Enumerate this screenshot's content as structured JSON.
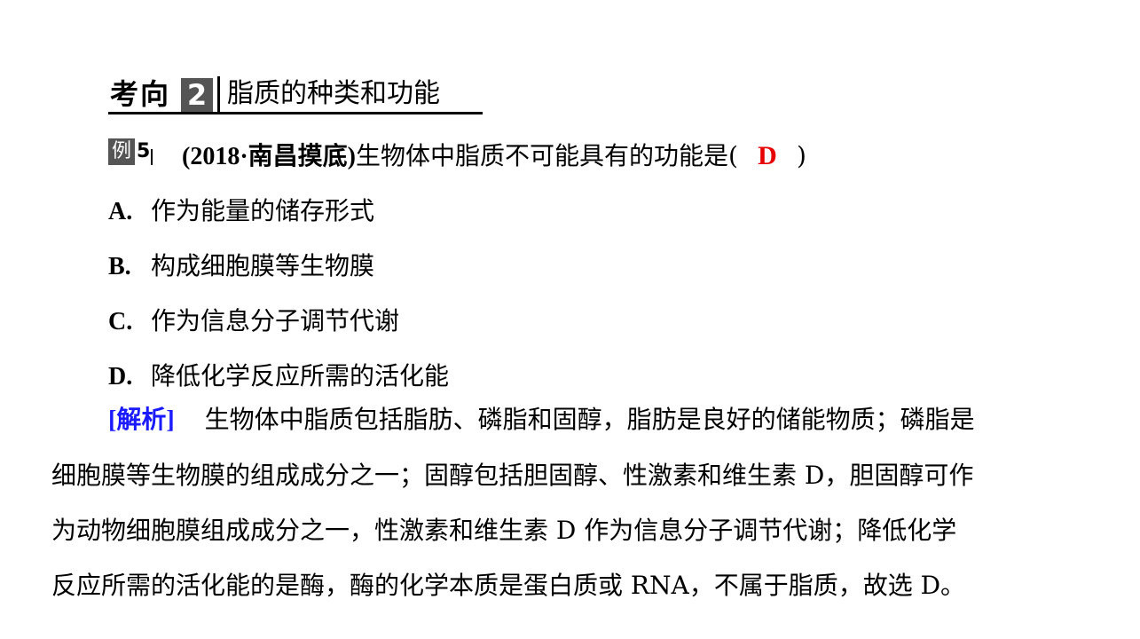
{
  "header": {
    "kaoxiang": "考向",
    "number": "2",
    "title": "脂质的种类和功能"
  },
  "example": {
    "label": "例",
    "number": "5",
    "source": "(2018·南昌摸底)",
    "stem": "生物体中脂质不可能具有的功能是(",
    "answer": "D",
    "close": ")"
  },
  "options": [
    {
      "letter": "A.",
      "text": "作为能量的储存形式"
    },
    {
      "letter": "B.",
      "text": "构成细胞膜等生物膜"
    },
    {
      "letter": "C.",
      "text": "作为信息分子调节代谢"
    },
    {
      "letter": "D.",
      "text": "降低化学反应所需的活化能"
    }
  ],
  "analysis": {
    "tag": "[解析]",
    "lines": [
      "生物体中脂质包括脂肪、磷脂和固醇，脂肪是良好的储能物质；磷脂是",
      "细胞膜等生物膜的组成成分之一；固醇包括胆固醇、性激素和维生素 D，胆固醇可作",
      "为动物细胞膜组成成分之一，性激素和维生素 D 作为信息分子调节代谢；降低化学",
      "反应所需的活化能的是酶，酶的化学本质是蛋白质或 RNA，不属于脂质，故选 D。"
    ]
  },
  "colors": {
    "answer": "#e60000",
    "tag": "#1a1aff",
    "badge": "#555555"
  }
}
